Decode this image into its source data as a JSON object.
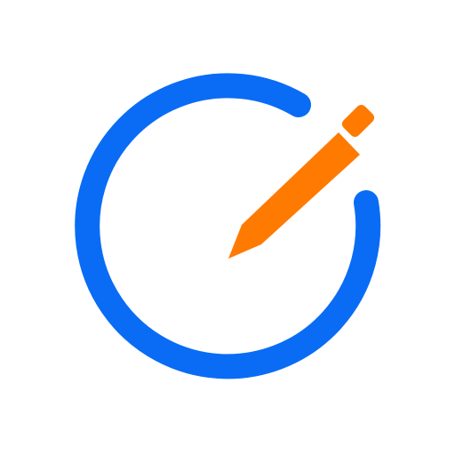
{
  "icon": {
    "name": "edit-pencil-circle-icon",
    "colors": {
      "ring": "#0A6CF5",
      "pencil": "#FF7A00",
      "background": "#FFFFFF"
    }
  }
}
